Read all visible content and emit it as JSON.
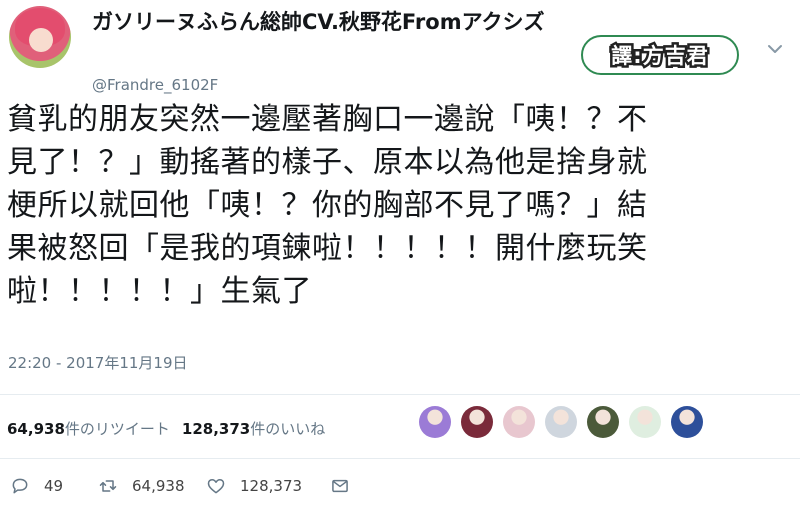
{
  "author": {
    "display_name": "ガソリーヌふらん総帥CV.秋野花Fromアクシズ",
    "handle": "@Frandre_6102F"
  },
  "translator_badge": "譯:方吉君",
  "tweet": {
    "lines": [
      "貧乳的朋友突然一邊壓著胸口一邊說「咦！？不",
      "見了！？」動搖著的樣子、原本以為他是捨身就",
      "梗所以就回他「咦！？你的胸部不見了嗎？」結",
      "果被怒回「是我的項鍊啦！！！！！開什麼玩笑",
      "啦！！！！！」生氣了"
    ],
    "timestamp": "22:20 - 2017年11月19日"
  },
  "stats": {
    "retweets_count": "64,938",
    "retweets_label": "件のリツイート",
    "likes_count": "128,373",
    "likes_label": "件のいいね"
  },
  "actions": {
    "reply_count": "49",
    "retweet_count": "64,938",
    "like_count": "128,373"
  },
  "likers": [
    "#9b7bd6",
    "#7a2a3a",
    "#e8c7cf",
    "#cfd6de",
    "#4b5a3a",
    "#dfeee0",
    "#2d4f9a"
  ],
  "colors": {
    "text": "#14171a",
    "muted": "#657786",
    "badge_border": "#2f8a52"
  },
  "icons": [
    "chevron-down-icon",
    "reply-icon",
    "retweet-icon",
    "like-icon",
    "dm-icon"
  ]
}
